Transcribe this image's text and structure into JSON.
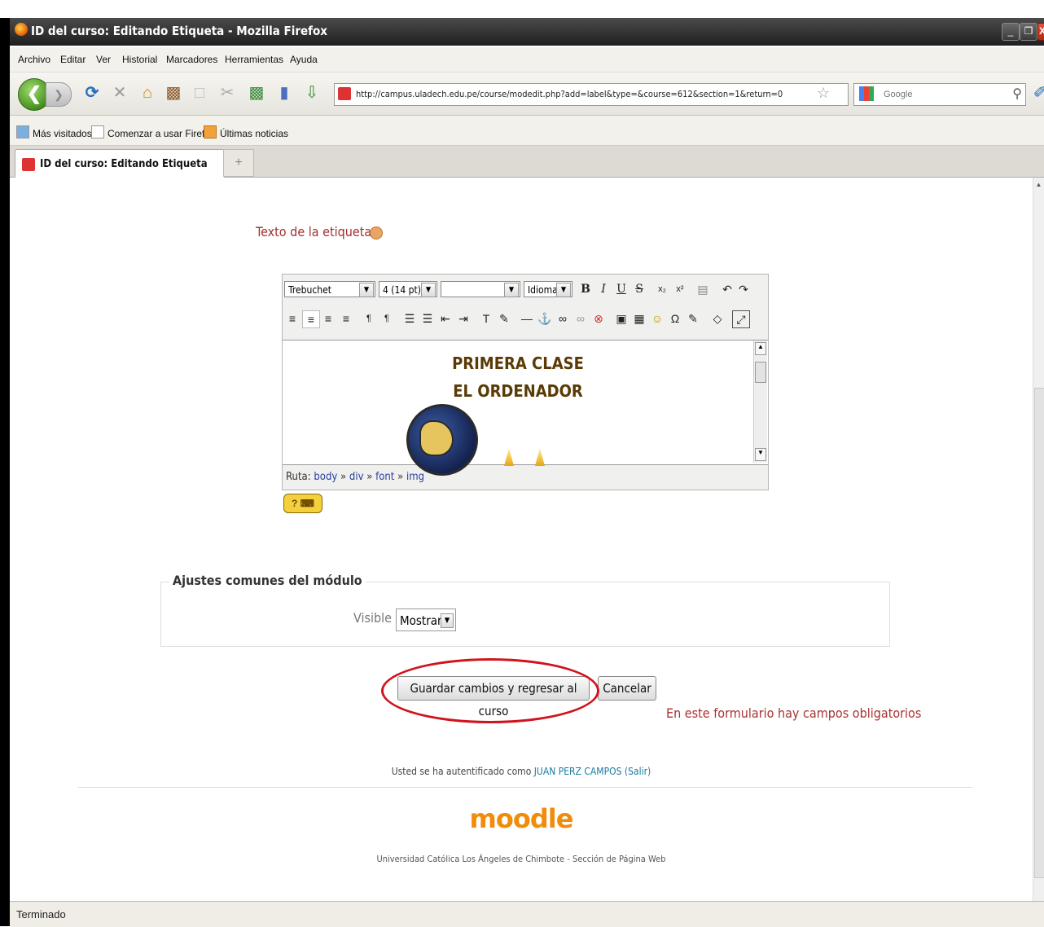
{
  "window": {
    "title": "ID del curso: Editando Etiqueta - Mozilla Firefox",
    "minimize": "_",
    "maximize": "❐",
    "close": "X"
  },
  "menu": [
    "Archivo",
    "Editar",
    "Ver",
    "Historial",
    "Marcadores",
    "Herramientas",
    "Ayuda"
  ],
  "toolbar": {
    "url": "http://campus.uladech.edu.pe/course/modedit.php?add=label&type=&course=612&section=1&return=0",
    "search_placeholder": "Google"
  },
  "bookmarks": [
    "Más visitados",
    "Comenzar a usar Firef...",
    "Últimas noticias"
  ],
  "tab": {
    "label": "ID del curso: Editando Etiqueta",
    "new_tab": "+"
  },
  "form": {
    "field_label": "Texto de la etiqueta*",
    "editor": {
      "font": "Trebuchet",
      "size": "4 (14 pt)",
      "format": "",
      "language": "Idioma",
      "content_line1": "PRIMERA CLASE",
      "content_line2": "EL ORDENADOR",
      "path_prefix": "Ruta:",
      "path": [
        "body",
        "div",
        "font",
        "img"
      ]
    },
    "module_settings_legend": "Ajustes comunes del módulo",
    "visible_label": "Visible",
    "visible_value": "Mostrar",
    "save_button": "Guardar cambios y regresar al curso",
    "cancel_button": "Cancelar",
    "required_note": "En este formulario hay campos obligatorios"
  },
  "footer": {
    "logged_prefix": "Usted se ha autentificado como",
    "user": "JUAN PERZ CAMPOS",
    "logout": "(Salir)",
    "logo": "moodle",
    "institution": "Universidad Católica Los Ángeles de Chimbote - Sección de Página Web"
  },
  "status": "Terminado",
  "colors": {
    "required": "#a83232",
    "annotation": "#d0141c",
    "moodle": "#f18c0b"
  }
}
